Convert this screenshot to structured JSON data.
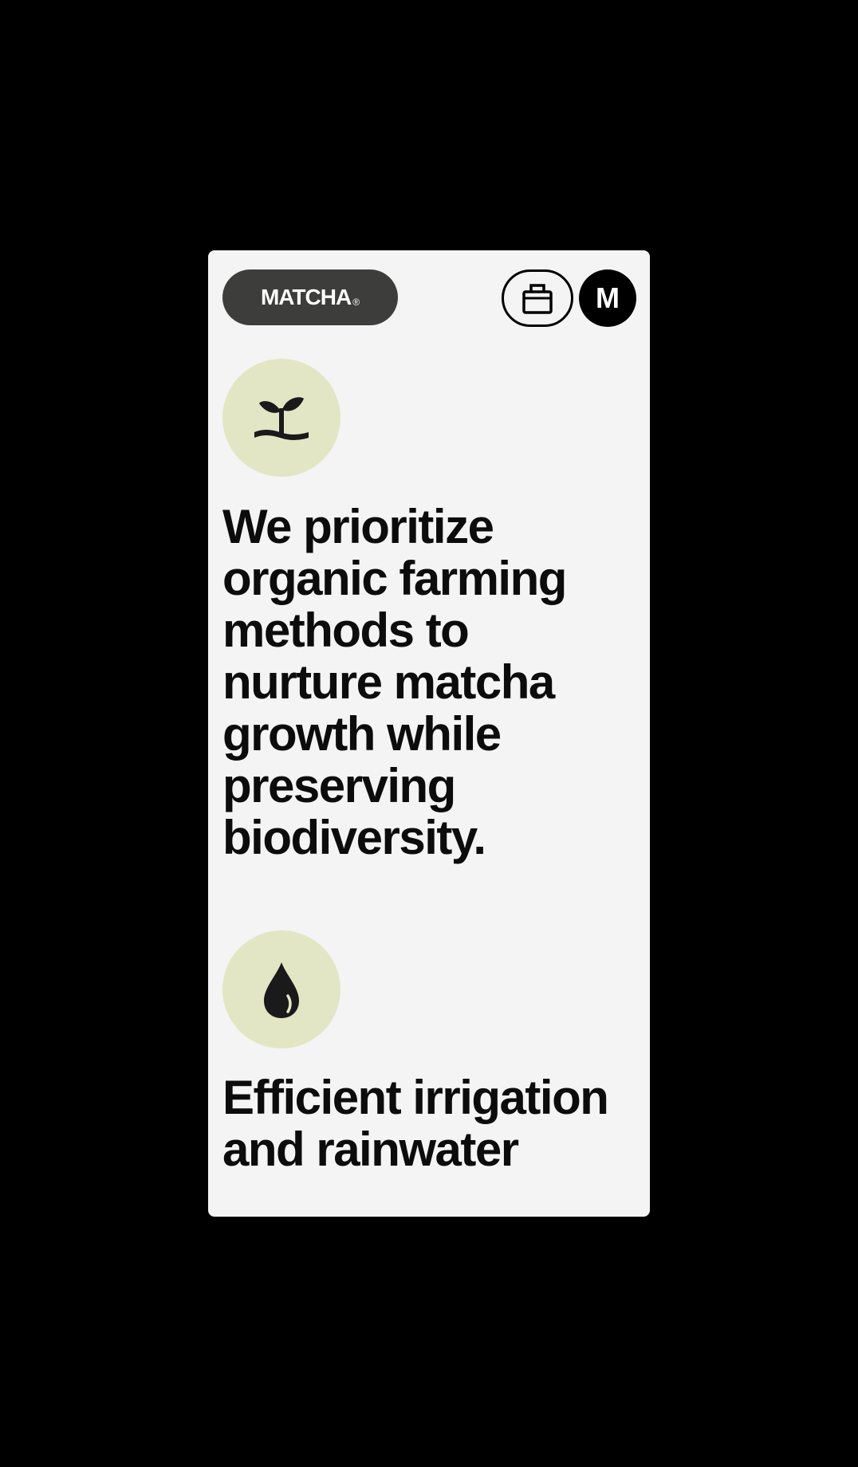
{
  "header": {
    "logo_text": "MATCHA",
    "logo_mark": "®",
    "cart_icon": "shopping-bag-icon",
    "menu_label": "M"
  },
  "features": [
    {
      "icon": "sprout-icon",
      "text": "We prioritize organic farming methods to nurture matcha growth while preserving biodiversity."
    },
    {
      "icon": "water-drop-icon",
      "text": "Efficient irrigation and rainwater"
    }
  ],
  "colors": {
    "background": "#000000",
    "surface": "#f4f4f4",
    "logo_pill": "#3d3e3c",
    "icon_circle": "#e2e6c4",
    "text": "#0c0c0c"
  }
}
